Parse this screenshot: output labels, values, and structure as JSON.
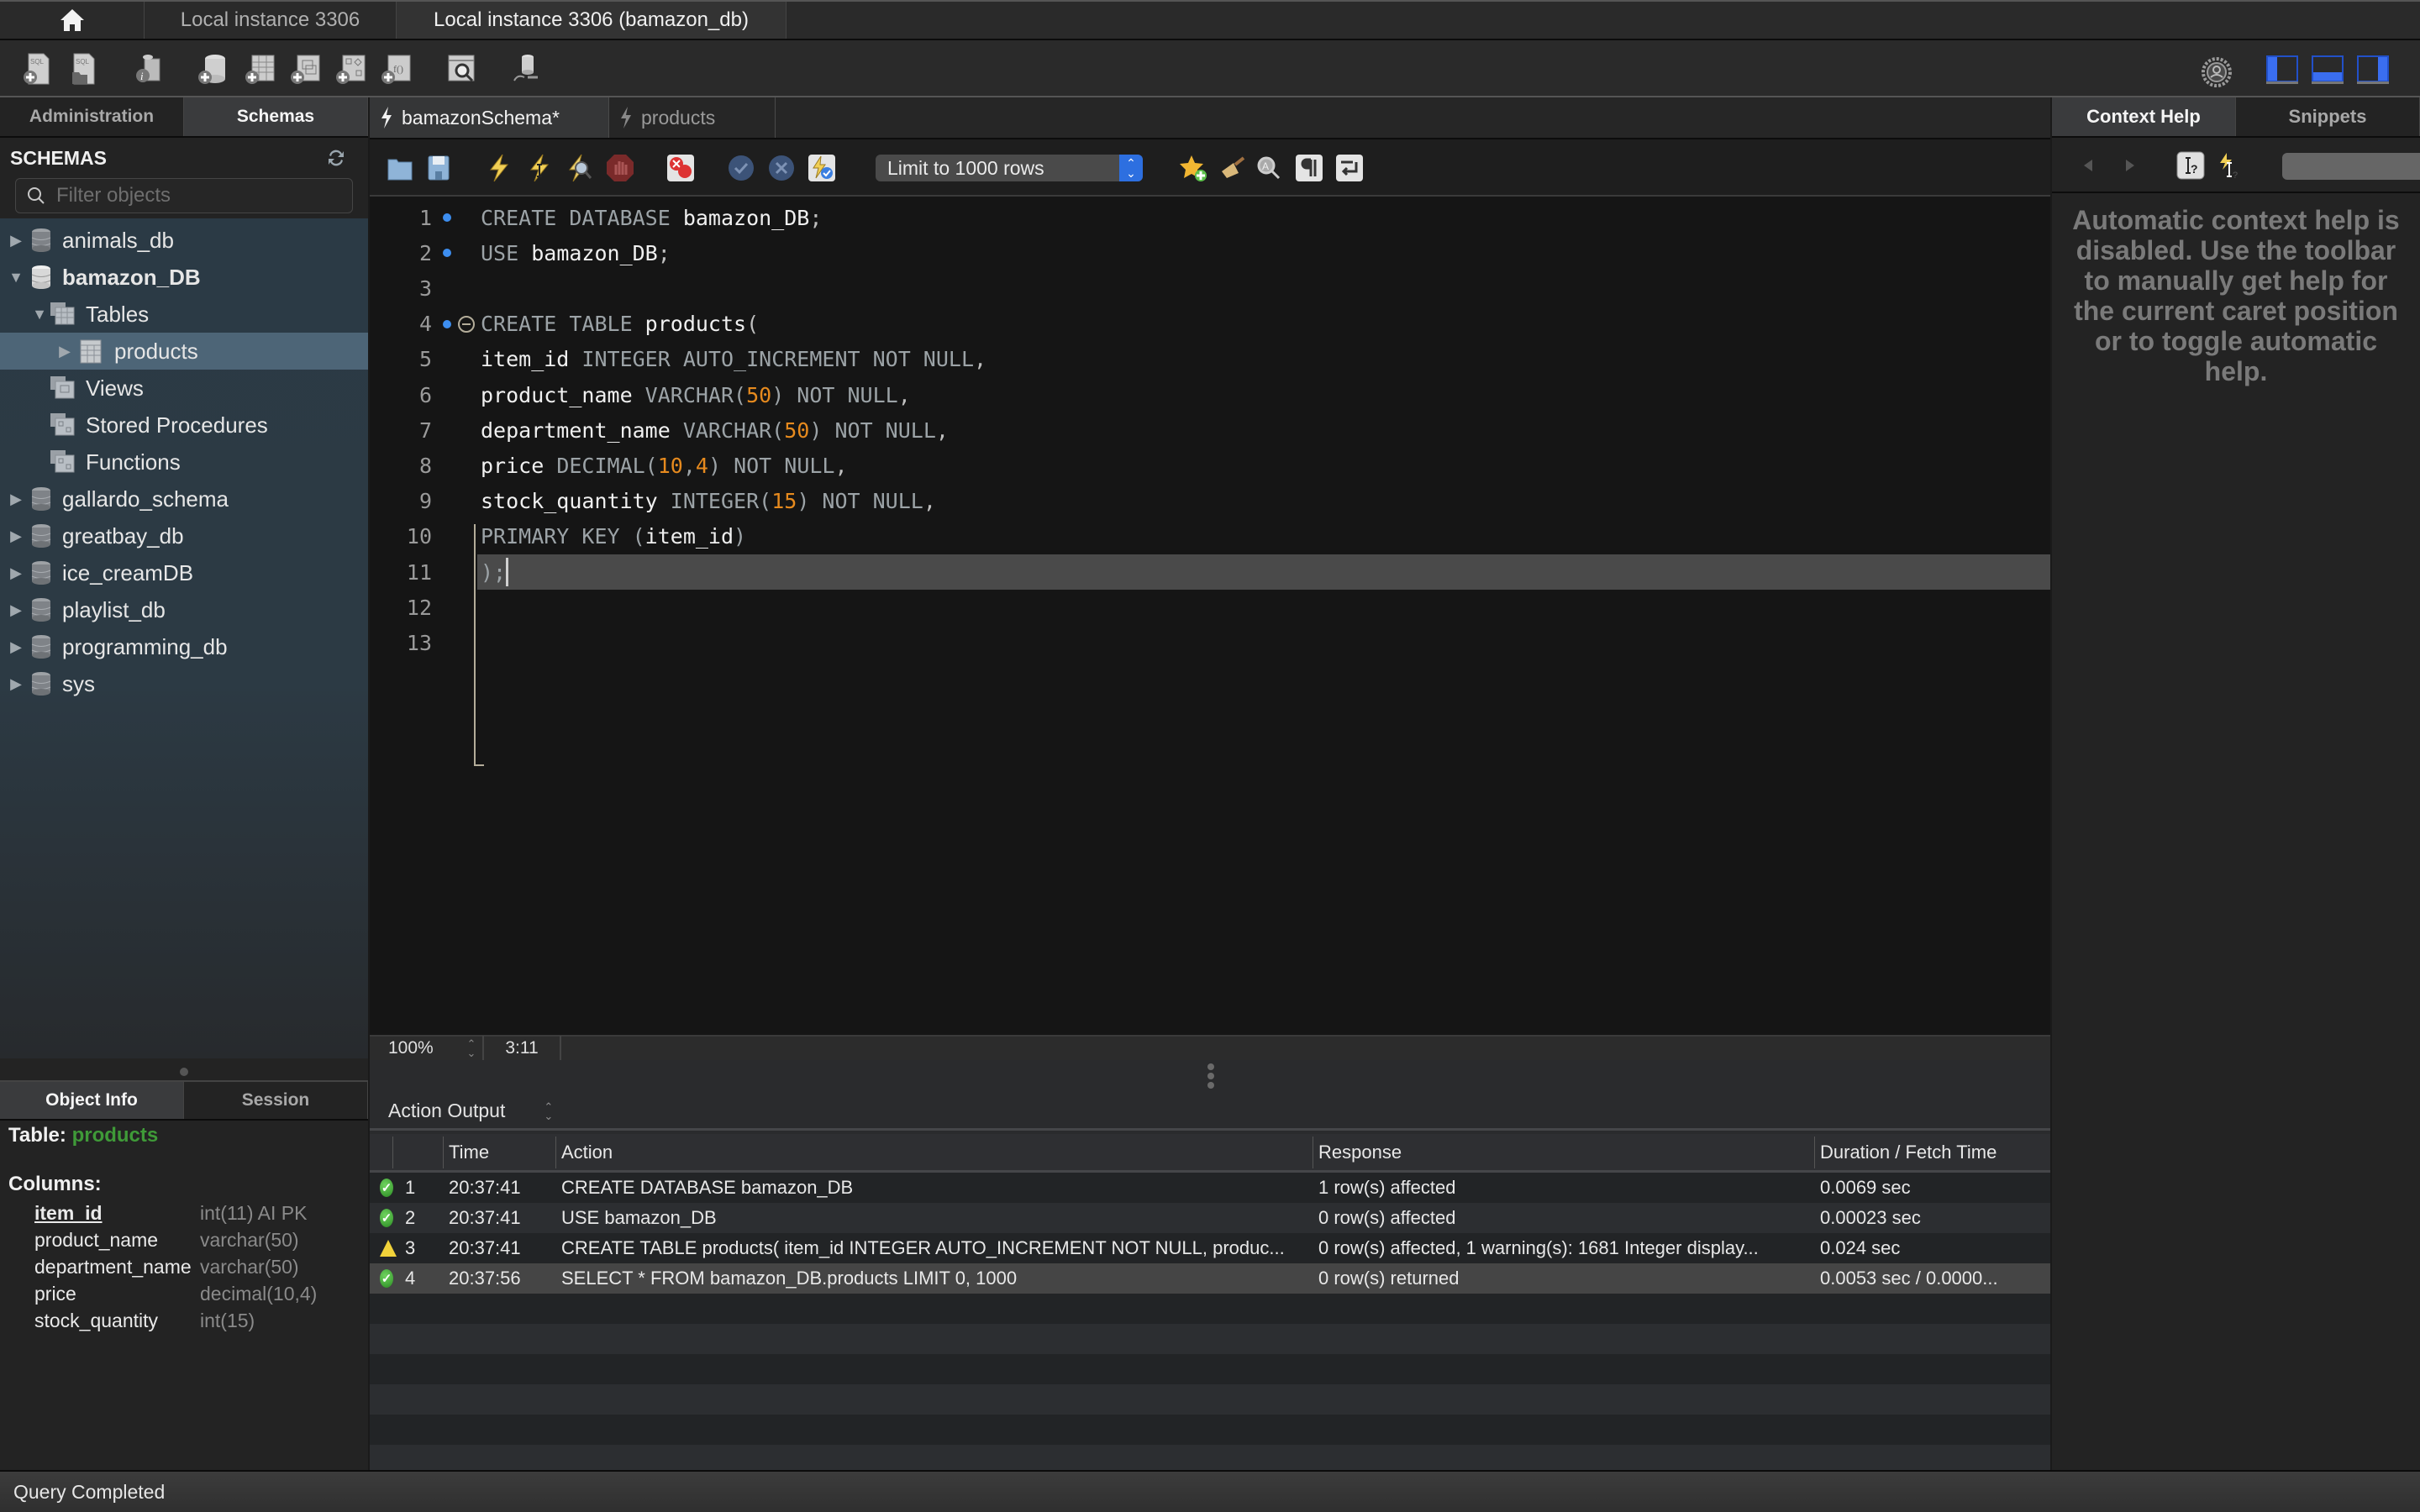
{
  "window": {
    "tabs": [
      {
        "label": "Local instance 3306",
        "active": false
      },
      {
        "label": "Local instance 3306 (bamazon_db)",
        "active": true
      }
    ]
  },
  "toolbar": {
    "icons": [
      "new-sql-tab-icon",
      "open-sql-script-icon",
      "inspector-icon",
      "create-schema-icon",
      "create-table-icon",
      "create-view-icon",
      "create-procedure-icon",
      "create-function-icon",
      "search-table-data-icon",
      "reconnect-icon"
    ],
    "right_icons": [
      "settings-icon",
      "toggle-sidebar-icon",
      "toggle-output-icon",
      "toggle-secondary-sidebar-icon"
    ]
  },
  "sidebar": {
    "tabs": [
      {
        "label": "Administration",
        "active": false
      },
      {
        "label": "Schemas",
        "active": true
      }
    ],
    "header": "SCHEMAS",
    "filter_placeholder": "Filter objects",
    "filter_value": "",
    "tree": [
      {
        "label": "animals_db",
        "type": "schema",
        "expanded": false,
        "level": 0
      },
      {
        "label": "bamazon_DB",
        "type": "schema",
        "expanded": true,
        "level": 0,
        "bold": true
      },
      {
        "label": "Tables",
        "type": "folder",
        "expanded": true,
        "level": 1
      },
      {
        "label": "products",
        "type": "table",
        "expanded": false,
        "level": 2,
        "selected": true
      },
      {
        "label": "Views",
        "type": "folder",
        "level": 1
      },
      {
        "label": "Stored Procedures",
        "type": "folder",
        "level": 1
      },
      {
        "label": "Functions",
        "type": "folder",
        "level": 1
      },
      {
        "label": "gallardo_schema",
        "type": "schema",
        "expanded": false,
        "level": 0
      },
      {
        "label": "greatbay_db",
        "type": "schema",
        "expanded": false,
        "level": 0
      },
      {
        "label": "ice_creamDB",
        "type": "schema",
        "expanded": false,
        "level": 0
      },
      {
        "label": "playlist_db",
        "type": "schema",
        "expanded": false,
        "level": 0
      },
      {
        "label": "programming_db",
        "type": "schema",
        "expanded": false,
        "level": 0
      },
      {
        "label": "sys",
        "type": "schema",
        "expanded": false,
        "level": 0
      }
    ],
    "info_tabs": [
      {
        "label": "Object Info",
        "active": true
      },
      {
        "label": "Session",
        "active": false
      }
    ],
    "object_info": {
      "table_label": "Table:",
      "table_name": "products",
      "columns_label": "Columns:",
      "columns": [
        {
          "name": "item_id",
          "type": "int(11) AI PK",
          "pk": true
        },
        {
          "name": "product_name",
          "type": "varchar(50)",
          "pk": false
        },
        {
          "name": "department_name",
          "type": "varchar(50)",
          "pk": false
        },
        {
          "name": "price",
          "type": "decimal(10,4)",
          "pk": false
        },
        {
          "name": "stock_quantity",
          "type": "int(15)",
          "pk": false
        }
      ]
    }
  },
  "editor": {
    "tabs": [
      {
        "label": "bamazonSchema*",
        "active": true
      },
      {
        "label": "products",
        "active": false
      }
    ],
    "limit_select": "Limit to 1000 rows",
    "lines": [
      {
        "n": "1",
        "marker": true,
        "tokens": [
          [
            "kw",
            "CREATE DATABASE "
          ],
          [
            "id",
            "bamazon_DB"
          ],
          [
            "punc",
            ";"
          ]
        ]
      },
      {
        "n": "2",
        "marker": true,
        "tokens": [
          [
            "kw",
            "USE "
          ],
          [
            "id",
            "bamazon_DB"
          ],
          [
            "punc",
            ";"
          ]
        ]
      },
      {
        "n": "3",
        "marker": false,
        "tokens": []
      },
      {
        "n": "4",
        "marker": true,
        "fold": true,
        "tokens": [
          [
            "kw",
            "CREATE TABLE "
          ],
          [
            "id",
            "products"
          ],
          [
            "punc",
            "("
          ]
        ]
      },
      {
        "n": "5",
        "marker": false,
        "tokens": [
          [
            "id",
            "item_id "
          ],
          [
            "kw",
            "INTEGER AUTO_INCREMENT NOT NULL"
          ],
          [
            "punc",
            ","
          ]
        ]
      },
      {
        "n": "6",
        "marker": false,
        "tokens": [
          [
            "id",
            "product_name "
          ],
          [
            "kw",
            "VARCHAR("
          ],
          [
            "num",
            "50"
          ],
          [
            "kw",
            ") NOT NULL"
          ],
          [
            "punc",
            ","
          ]
        ]
      },
      {
        "n": "7",
        "marker": false,
        "tokens": [
          [
            "id",
            "department_name "
          ],
          [
            "kw",
            "VARCHAR("
          ],
          [
            "num",
            "50"
          ],
          [
            "kw",
            ") NOT NULL"
          ],
          [
            "punc",
            ","
          ]
        ]
      },
      {
        "n": "8",
        "marker": false,
        "tokens": [
          [
            "id",
            "price "
          ],
          [
            "kw",
            "DECIMAL("
          ],
          [
            "num",
            "10"
          ],
          [
            "kw",
            ","
          ],
          [
            "num",
            "4"
          ],
          [
            "kw",
            ") NOT NULL"
          ],
          [
            "punc",
            ","
          ]
        ]
      },
      {
        "n": "9",
        "marker": false,
        "tokens": [
          [
            "id",
            "stock_quantity "
          ],
          [
            "kw",
            "INTEGER("
          ],
          [
            "num",
            "15"
          ],
          [
            "kw",
            ") NOT NULL"
          ],
          [
            "punc",
            ","
          ]
        ]
      },
      {
        "n": "10",
        "marker": false,
        "tokens": [
          [
            "kw",
            "PRIMARY KEY ("
          ],
          [
            "id",
            "item_id"
          ],
          [
            "kw",
            ")"
          ]
        ]
      },
      {
        "n": "11",
        "marker": false,
        "current": true,
        "tokens": [
          [
            "kw",
            ");"
          ]
        ]
      },
      {
        "n": "12",
        "marker": false,
        "tokens": []
      },
      {
        "n": "13",
        "marker": false,
        "tokens": []
      }
    ],
    "zoom": "100%",
    "cursor_pos": "3:11"
  },
  "output": {
    "selector_label": "Action Output",
    "columns": [
      "",
      "",
      "Time",
      "Action",
      "Response",
      "Duration / Fetch Time"
    ],
    "rows": [
      {
        "status": "ok",
        "num": "1",
        "time": "20:37:41",
        "action": "CREATE DATABASE bamazon_DB",
        "response": "1 row(s) affected",
        "duration": "0.0069 sec"
      },
      {
        "status": "ok",
        "num": "2",
        "time": "20:37:41",
        "action": "USE bamazon_DB",
        "response": "0 row(s) affected",
        "duration": "0.00023 sec"
      },
      {
        "status": "warning",
        "num": "3",
        "time": "20:37:41",
        "action": "CREATE TABLE products( item_id INTEGER AUTO_INCREMENT NOT NULL, produc...",
        "response": "0 row(s) affected, 1 warning(s): 1681 Integer display...",
        "duration": "0.024 sec"
      },
      {
        "status": "ok",
        "num": "4",
        "time": "20:37:56",
        "action": "SELECT * FROM bamazon_DB.products LIMIT 0, 1000",
        "response": "0 row(s) returned",
        "duration": "0.0053 sec / 0.0000..."
      }
    ]
  },
  "right_panel": {
    "tabs": [
      {
        "label": "Context Help",
        "active": true
      },
      {
        "label": "Snippets",
        "active": false
      }
    ],
    "help_text": "Automatic context help is disabled. Use the toolbar to manually get help for the current caret position or to toggle automatic help."
  },
  "status_bar": {
    "text": "Query Completed"
  },
  "colors": {
    "accent_blue": "#2d6fe0",
    "marker_blue": "#3d8ef0",
    "number_orange": "#e68a1e",
    "table_green": "#3f9a38",
    "warning_yellow": "#f1d23a"
  }
}
